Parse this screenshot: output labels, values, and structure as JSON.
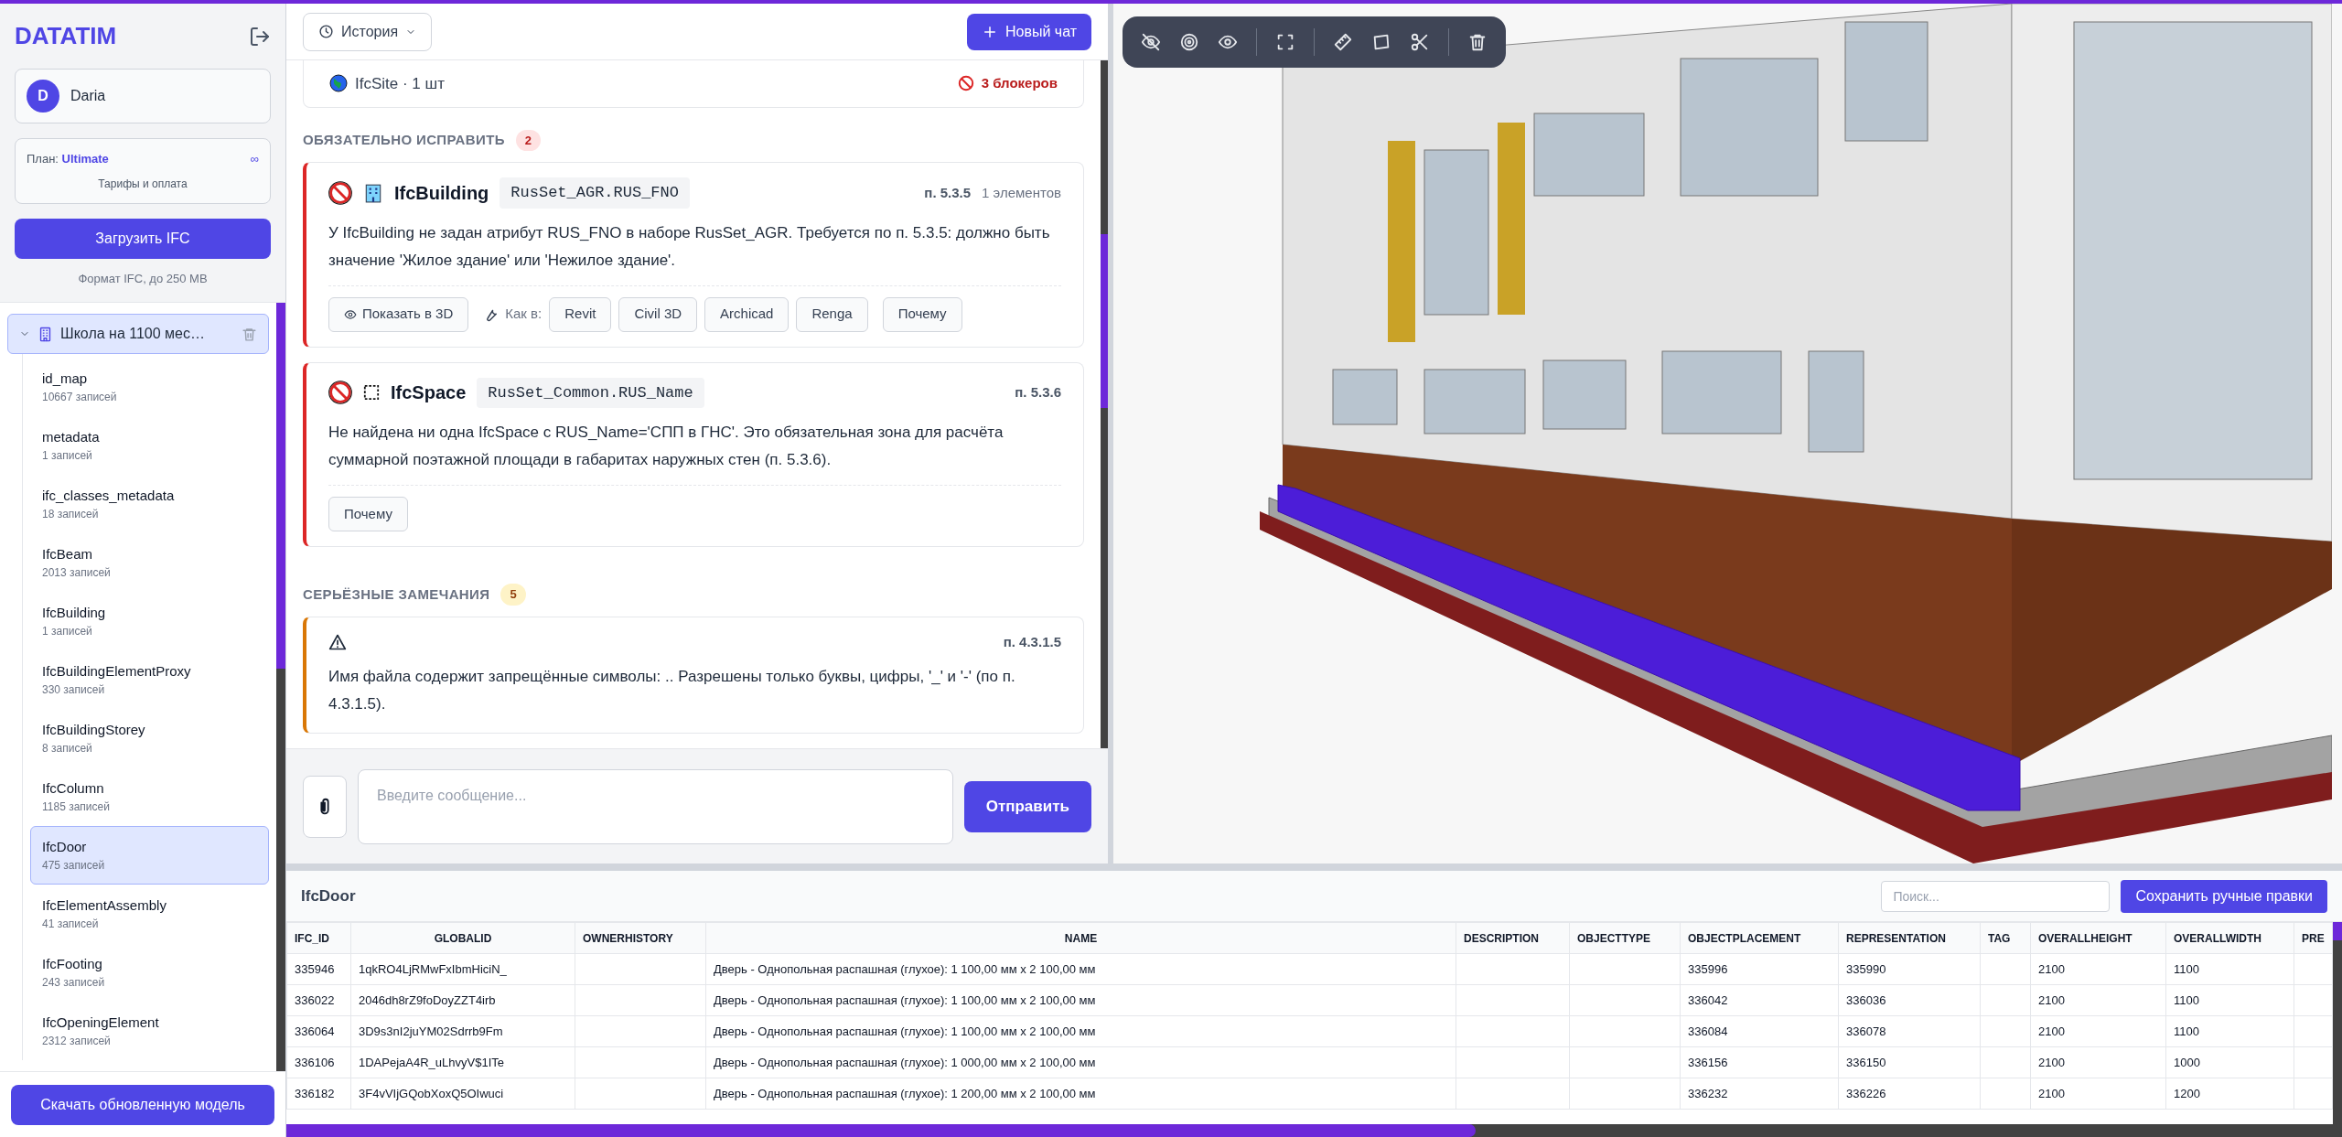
{
  "sidebar": {
    "logo": "DATATIM",
    "user": {
      "initial": "D",
      "name": "Daria"
    },
    "plan": {
      "label": "План:",
      "value": "Ultimate",
      "limit": "∞",
      "link": "Тарифы и оплата"
    },
    "upload_button": "Загрузить IFC",
    "upload_hint": "Формат IFC, до 250 MB",
    "project": {
      "name": "Школа на 1100 мес…",
      "expanded": true,
      "children": [
        {
          "name": "id_map",
          "count": "10667 записей",
          "selected": false
        },
        {
          "name": "metadata",
          "count": "1 записей",
          "selected": false
        },
        {
          "name": "ifc_classes_metadata",
          "count": "18 записей",
          "selected": false
        },
        {
          "name": "IfcBeam",
          "count": "2013 записей",
          "selected": false
        },
        {
          "name": "IfcBuilding",
          "count": "1 записей",
          "selected": false
        },
        {
          "name": "IfcBuildingElementProxy",
          "count": "330 записей",
          "selected": false
        },
        {
          "name": "IfcBuildingStorey",
          "count": "8 записей",
          "selected": false
        },
        {
          "name": "IfcColumn",
          "count": "1185 записей",
          "selected": false
        },
        {
          "name": "IfcDoor",
          "count": "475 записей",
          "selected": true
        },
        {
          "name": "IfcElementAssembly",
          "count": "41 записей",
          "selected": false
        },
        {
          "name": "IfcFooting",
          "count": "243 записей",
          "selected": false
        },
        {
          "name": "IfcOpeningElement",
          "count": "2312 записей",
          "selected": false
        }
      ]
    },
    "download_button": "Скачать обновленную модель"
  },
  "chat": {
    "history_button": "История",
    "new_chat_button": "Новый чат",
    "summary": {
      "object": "IfcSite · 1 шт",
      "blockers": "3 блокеров"
    },
    "sections": [
      {
        "kind": "critical",
        "title": "ОБЯЗАТЕЛЬНО ИСПРАВИТЬ",
        "count": "2",
        "issues": [
          {
            "kind": "building",
            "entity": "IfcBuilding",
            "attribute": "RusSet_AGR.RUS_FNO",
            "clause": "п. 5.3.5",
            "elements": "1 элементов",
            "text": "У IfcBuilding не задан атрибут RUS_FNO в наборе RusSet_AGR. Требуется по п. 5.3.5: должно быть значение 'Жилое здание' или 'Нежилое здание'.",
            "show_3d": "Показать в 3D",
            "how_in": "Как в:",
            "apps": [
              "Revit",
              "Civil 3D",
              "Archicad",
              "Renga"
            ],
            "why": "Почему"
          },
          {
            "kind": "space",
            "entity": "IfcSpace",
            "attribute": "RusSet_Common.RUS_Name",
            "clause": "п. 5.3.6",
            "text": "Не найдена ни одна IfcSpace с RUS_Name='СПП в ГНС'. Это обязательная зона для расчёта суммарной поэтажной площади в габаритах наружных стен (п. 5.3.6).",
            "why": "Почему"
          }
        ]
      },
      {
        "kind": "serious",
        "title": "СЕРЬЁЗНЫЕ ЗАМЕЧАНИЯ",
        "count": "5",
        "issues": [
          {
            "clause": "п. 4.3.1.5",
            "text": "Имя файла содержит запрещённые символы: .. Разрешены только буквы, цифры, '_' и '-' (по п. 4.3.1.5)."
          }
        ]
      }
    ],
    "composer": {
      "placeholder": "Введите сообщение...",
      "send_button": "Отправить"
    }
  },
  "table": {
    "title": "IfcDoor",
    "search": {
      "placeholder": "Поиск..."
    },
    "save_button": "Сохранить ручные правки",
    "columns": [
      "IFC_ID",
      "GLOBALID",
      "OWNERHISTORY",
      "NAME",
      "DESCRIPTION",
      "OBJECTTYPE",
      "OBJECTPLACEMENT",
      "REPRESENTATION",
      "TAG",
      "OVERALLHEIGHT",
      "OVERALLWIDTH",
      "PRE"
    ],
    "rows": [
      [
        "335946",
        "1qkRO4LjRMwFxIbmHiciN_",
        "",
        "Дверь - Однопольная распашная (глухое): 1 100,00 мм x 2 100,00 мм",
        "",
        "",
        "335996",
        "335990",
        "",
        "2100",
        "1100",
        ""
      ],
      [
        "336022",
        "2046dh8rZ9foDoyZZT4irb",
        "",
        "Дверь - Однопольная распашная (глухое): 1 100,00 мм x 2 100,00 мм",
        "",
        "",
        "336042",
        "336036",
        "",
        "2100",
        "1100",
        ""
      ],
      [
        "336064",
        "3D9s3nI2juYM02Sdrrb9Fm",
        "",
        "Дверь - Однопольная распашная (глухое): 1 100,00 мм x 2 100,00 мм",
        "",
        "",
        "336084",
        "336078",
        "",
        "2100",
        "1100",
        ""
      ],
      [
        "336106",
        "1DAPejaA4R_uLhvyV$1ITe",
        "",
        "Дверь - Однопольная распашная (глухое): 1 000,00 мм x 2 100,00 мм",
        "",
        "",
        "336156",
        "336150",
        "",
        "2100",
        "1000",
        ""
      ],
      [
        "336182",
        "3F4vVIjGQobXoxQ5OIwuci",
        "",
        "Дверь - Однопольная распашная (глухое): 1 200,00 мм x 2 100,00 мм",
        "",
        "",
        "336232",
        "336226",
        "",
        "2100",
        "1200",
        ""
      ]
    ]
  }
}
